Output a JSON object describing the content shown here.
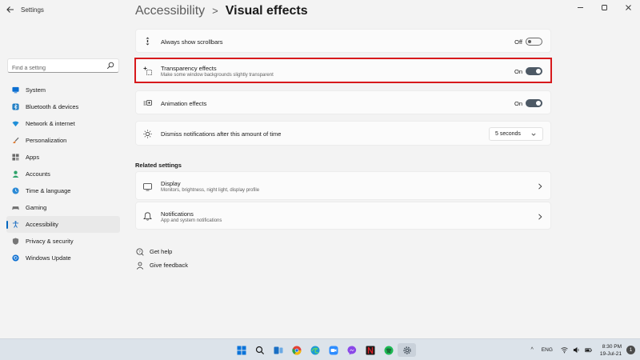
{
  "window": {
    "title": "Settings",
    "back_icon": "back-arrow-icon",
    "controls": [
      "minimize",
      "maximize",
      "close"
    ]
  },
  "search": {
    "placeholder": "Find a setting",
    "icon": "search-icon"
  },
  "sidebar": {
    "items": [
      {
        "label": "System",
        "icon": "monitor-icon",
        "color": "#0a6ed1",
        "active": false
      },
      {
        "label": "Bluetooth & devices",
        "icon": "bluetooth-icon",
        "color": "#1d7dc4",
        "active": false
      },
      {
        "label": "Network & internet",
        "icon": "wifi-icon",
        "color": "#1f8fd8",
        "active": false
      },
      {
        "label": "Personalization",
        "icon": "brush-icon",
        "color": "#e07a2f",
        "active": false
      },
      {
        "label": "Apps",
        "icon": "apps-icon",
        "color": "#6b6b6b",
        "active": false
      },
      {
        "label": "Accounts",
        "icon": "person-icon",
        "color": "#2fa36b",
        "active": false
      },
      {
        "label": "Time & language",
        "icon": "globe-clock-icon",
        "color": "#2b8ad6",
        "active": false
      },
      {
        "label": "Gaming",
        "icon": "gamepad-icon",
        "color": "#707070",
        "active": false
      },
      {
        "label": "Accessibility",
        "icon": "accessibility-icon",
        "color": "#1b6ec2",
        "active": true
      },
      {
        "label": "Privacy & security",
        "icon": "shield-icon",
        "color": "#777777",
        "active": false
      },
      {
        "label": "Windows Update",
        "icon": "update-icon",
        "color": "#0a6ed1",
        "active": false
      }
    ]
  },
  "header": {
    "parent": "Accessibility",
    "separator": ">",
    "current": "Visual effects"
  },
  "settings": {
    "scrollbars": {
      "title": "Always show scrollbars",
      "state": "Off",
      "on": false
    },
    "transparency": {
      "title": "Transparency effects",
      "description": "Make some window backgrounds slightly transparent",
      "state": "On",
      "on": true,
      "highlighted": true
    },
    "animation": {
      "title": "Animation effects",
      "state": "On",
      "on": true
    },
    "notifications_dismiss": {
      "title": "Dismiss notifications after this amount of time",
      "value": "5 seconds"
    }
  },
  "related": {
    "heading": "Related settings",
    "items": [
      {
        "title": "Display",
        "description": "Monitors, brightness, night light, display profile",
        "icon": "display-icon"
      },
      {
        "title": "Notifications",
        "description": "App and system notifications",
        "icon": "bell-icon"
      }
    ]
  },
  "help": {
    "links": [
      {
        "label": "Get help",
        "icon": "help-icon"
      },
      {
        "label": "Give feedback",
        "icon": "feedback-icon"
      }
    ]
  },
  "taskbar": {
    "apps": [
      {
        "name": "start-icon",
        "color": "#0a73d9",
        "active": false
      },
      {
        "name": "search-icon",
        "color": "#1a1a1a",
        "active": false
      },
      {
        "name": "task-view-icon",
        "color": "#1a6fc4",
        "active": false
      },
      {
        "name": "chrome-icon",
        "color": "#e34133",
        "active": false
      },
      {
        "name": "edge-icon",
        "color": "#1c9ad6",
        "active": false
      },
      {
        "name": "zoom-icon",
        "color": "#2d8cff",
        "active": false
      },
      {
        "name": "messenger-icon",
        "color": "#8a48e8",
        "active": false
      },
      {
        "name": "netflix-icon",
        "color": "#d81f26",
        "active": false
      },
      {
        "name": "spotify-icon",
        "color": "#1db954",
        "active": false
      },
      {
        "name": "settings-gear-icon",
        "color": "#4f5b66",
        "active": true
      }
    ],
    "tray": {
      "chevron": "^",
      "language": "ENG",
      "time": "8:30 PM",
      "date": "19-Jul-21",
      "notifications": "1"
    }
  }
}
